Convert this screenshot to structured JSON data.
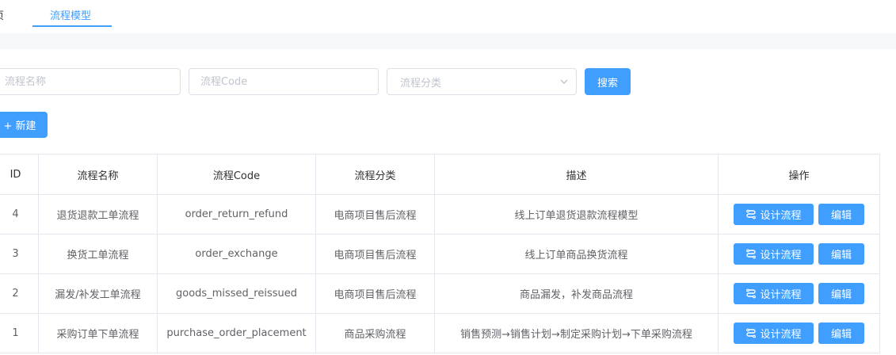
{
  "tabs": [
    {
      "label": "页"
    },
    {
      "label": "流程模型",
      "active": true
    }
  ],
  "search": {
    "name_placeholder": "流程名称",
    "code_placeholder": "流程Code",
    "category_placeholder": "流程分类",
    "search_label": "搜索"
  },
  "toolbar": {
    "new_label": "+ 新建"
  },
  "table": {
    "columns": [
      "ID",
      "流程名称",
      "流程Code",
      "流程分类",
      "描述",
      "操作"
    ],
    "rows": [
      {
        "id": "4",
        "name": "退货退款工单流程",
        "code": "order_return_refund",
        "category": "电商项目售后流程",
        "desc": "线上订单退货退款流程模型"
      },
      {
        "id": "3",
        "name": "换货工单流程",
        "code": "order_exchange",
        "category": "电商项目售后流程",
        "desc": "线上订单商品换货流程"
      },
      {
        "id": "2",
        "name": "漏发/补发工单流程",
        "code": "goods_missed_reissued",
        "category": "电商项目售后流程",
        "desc": "商品漏发，补发商品流程"
      },
      {
        "id": "1",
        "name": "采购订单下单流程",
        "code": "purchase_order_placement",
        "category": "商品采购流程",
        "desc": "销售预测→销售计划→制定采购计划→下单采购流程"
      }
    ],
    "design_label": "设计流程",
    "edit_label": "编辑"
  },
  "icons": {
    "design": "flow-design-icon",
    "select_arrow": "chevron-down-icon"
  },
  "colors": {
    "primary": "#409eff",
    "border": "#e4e7ed",
    "text": "#606266"
  }
}
